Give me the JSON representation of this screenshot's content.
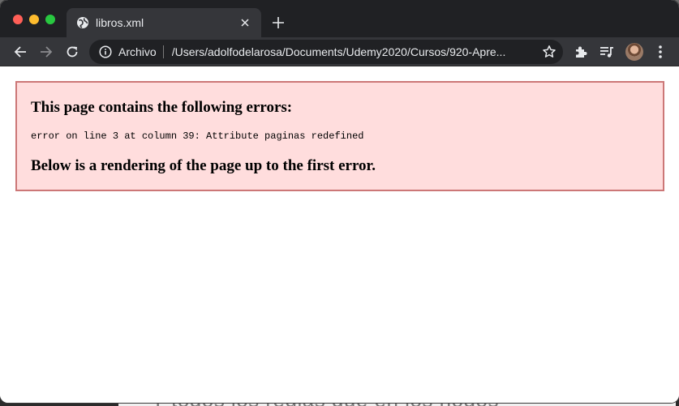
{
  "browser": {
    "tab": {
      "title": "libros.xml"
    },
    "omnibox": {
      "security_label": "Archivo",
      "url": "/Users/adolfodelarosa/Documents/Udemy2020/Cursos/920-Apre..."
    }
  },
  "page": {
    "error_heading": "This page contains the following errors:",
    "error_message": "error on line 3 at column 39: Attribute paginas redefined",
    "render_heading": "Below is a rendering of the page up to the first error."
  },
  "background": {
    "bottom_text": "Y todos los reglas que en los nodos"
  },
  "colors": {
    "tabstrip": "#202124",
    "toolbar": "#35363a",
    "error_bg": "#ffdddd",
    "error_border": "#cc7777"
  }
}
